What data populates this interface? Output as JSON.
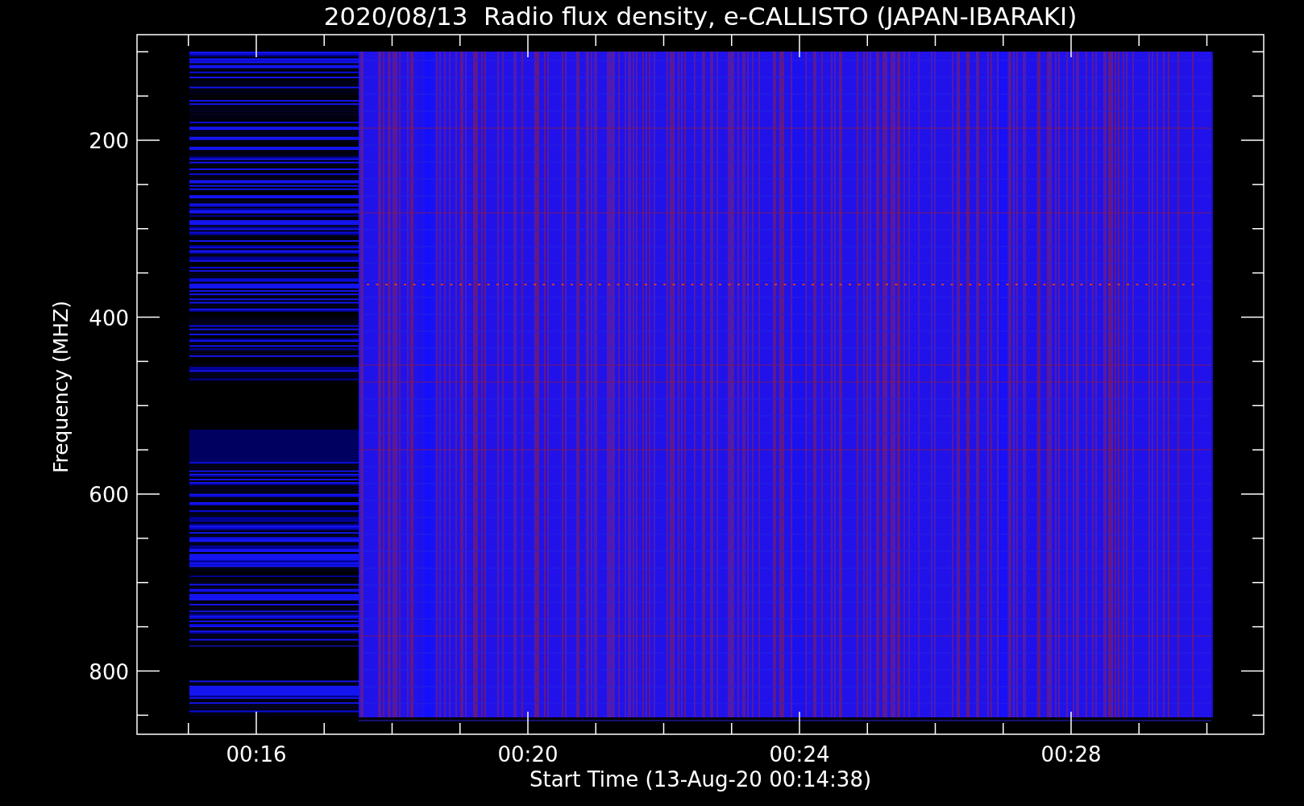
{
  "plot": {
    "title": "2020/08/13  Radio flux density, e-CALLISTO (JAPAN-IBARAKI)",
    "y_axis": {
      "label": "Frequency (MHZ)",
      "ticks": [
        "200",
        "400",
        "600",
        "800"
      ]
    },
    "x_axis": {
      "label": "Start Time (13-Aug-20 00:14:38)",
      "ticks": [
        "00:16",
        "00:20",
        "00:24",
        "00:28"
      ]
    }
  }
}
